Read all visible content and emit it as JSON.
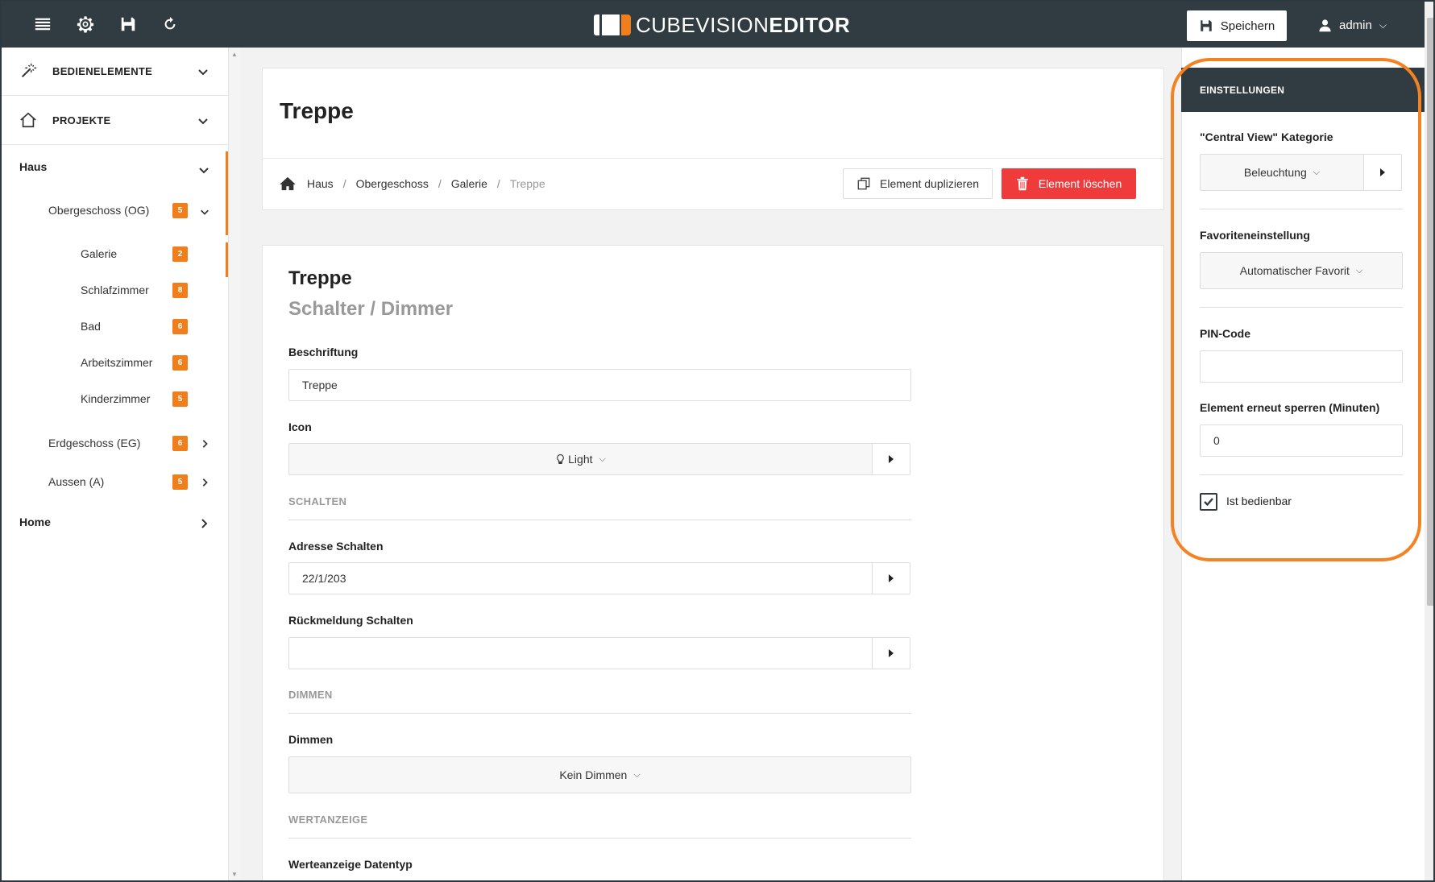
{
  "app": {
    "logo_light": "CUBEVISION",
    "logo_bold": "EDITOR"
  },
  "topbar": {
    "save_label": "Speichern",
    "user_name": "admin"
  },
  "sidebar": {
    "sections": [
      {
        "label": "BEDIENELEMENTE",
        "icon": "magic-wand-icon"
      },
      {
        "label": "PROJEKTE",
        "icon": "home-icon"
      }
    ],
    "tree": {
      "root": "Haus",
      "floors": [
        {
          "label": "Obergeschoss (OG)",
          "count": "5",
          "rooms": [
            {
              "label": "Galerie",
              "count": "2"
            },
            {
              "label": "Schlafzimmer",
              "count": "8"
            },
            {
              "label": "Bad",
              "count": "6"
            },
            {
              "label": "Arbeitszimmer",
              "count": "6"
            },
            {
              "label": "Kinderzimmer",
              "count": "5"
            }
          ]
        },
        {
          "label": "Erdgeschoss (EG)",
          "count": "6"
        },
        {
          "label": "Aussen (A)",
          "count": "5"
        }
      ],
      "other_root": "Home"
    }
  },
  "page": {
    "title": "Treppe",
    "breadcrumb": [
      "Haus",
      "Obergeschoss",
      "Galerie",
      "Treppe"
    ],
    "duplicate_label": "Element duplizieren",
    "delete_label": "Element löschen"
  },
  "form": {
    "element_name": "Treppe",
    "element_type": "Schalter / Dimmer",
    "label_field": {
      "label": "Beschriftung",
      "value": "Treppe"
    },
    "icon_field": {
      "label": "Icon",
      "value": "Light"
    },
    "section_schalten": "SCHALTEN",
    "adresse_schalten": {
      "label": "Adresse Schalten",
      "value": "22/1/203"
    },
    "rueckmeldung_schalten": {
      "label": "Rückmeldung Schalten",
      "value": ""
    },
    "section_dimmen": "DIMMEN",
    "dimmen": {
      "label": "Dimmen",
      "value": "Kein Dimmen"
    },
    "section_wertanzeige": "WERTANZEIGE",
    "werteanzeige_datentyp": {
      "label": "Werteanzeige Datentyp"
    }
  },
  "settings": {
    "header": "EINSTELLUNGEN",
    "category": {
      "label": "\"Central View\" Kategorie",
      "value": "Beleuchtung"
    },
    "favorite": {
      "label": "Favoriteneinstellung",
      "value": "Automatischer Favorit"
    },
    "pin": {
      "label": "PIN-Code",
      "value": ""
    },
    "relock": {
      "label": "Element erneut sperren (Minuten)",
      "value": "0"
    },
    "operable": {
      "label": "Ist bedienbar",
      "checked": true
    }
  },
  "colors": {
    "topbar": "#303c42",
    "accent": "#f07e1a",
    "danger": "#ef3b3b",
    "highlight": "#f58220"
  }
}
